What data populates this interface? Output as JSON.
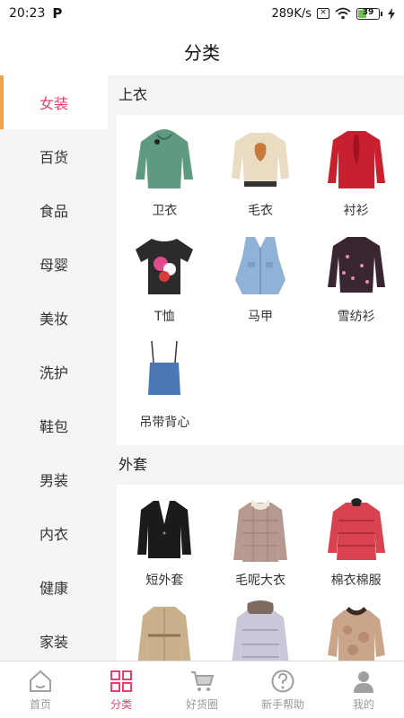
{
  "status_bar": {
    "time": "20:23",
    "app_icon": "P",
    "network_speed": "289K/s",
    "battery_level": "39"
  },
  "header": {
    "title": "分类"
  },
  "sidebar": {
    "items": [
      {
        "label": "女装",
        "active": true
      },
      {
        "label": "百货"
      },
      {
        "label": "食品"
      },
      {
        "label": "母婴"
      },
      {
        "label": "美妆"
      },
      {
        "label": "洗护"
      },
      {
        "label": "鞋包"
      },
      {
        "label": "男装"
      },
      {
        "label": "内衣"
      },
      {
        "label": "健康"
      },
      {
        "label": "家装"
      }
    ]
  },
  "sections": [
    {
      "title": "上衣",
      "items": [
        {
          "label": "卫衣",
          "icon": "hoodie",
          "color": "#5e9a80"
        },
        {
          "label": "毛衣",
          "icon": "sweater",
          "color": "#e9dcc2"
        },
        {
          "label": "衬衫",
          "icon": "blouse",
          "color": "#c8202e"
        },
        {
          "label": "T恤",
          "icon": "tshirt",
          "color": "#2b2b2b"
        },
        {
          "label": "马甲",
          "icon": "vest",
          "color": "#8fb3d6"
        },
        {
          "label": "雪纺衫",
          "icon": "chiffon",
          "color": "#3a2632"
        },
        {
          "label": "吊带背心",
          "icon": "camisole",
          "color": "#4a78b5"
        }
      ]
    },
    {
      "title": "外套",
      "items": [
        {
          "label": "短外套",
          "icon": "blazer",
          "color": "#1b1b1b"
        },
        {
          "label": "毛呢大衣",
          "icon": "wool-coat",
          "color": "#b79a8f"
        },
        {
          "label": "棉衣棉服",
          "icon": "puffer",
          "color": "#d8434f"
        },
        {
          "label": "",
          "icon": "trench",
          "color": "#c9b18c"
        },
        {
          "label": "",
          "icon": "down-jacket",
          "color": "#c9c7d9"
        },
        {
          "label": "",
          "icon": "fur-coat",
          "color": "#caa58a"
        }
      ]
    }
  ],
  "tabbar": {
    "tabs": [
      {
        "label": "首页",
        "icon": "home-icon"
      },
      {
        "label": "分类",
        "icon": "category-icon",
        "active": true
      },
      {
        "label": "好货圈",
        "icon": "cart-icon"
      },
      {
        "label": "新手帮助",
        "icon": "help-icon"
      },
      {
        "label": "我的",
        "icon": "profile-icon"
      }
    ]
  }
}
